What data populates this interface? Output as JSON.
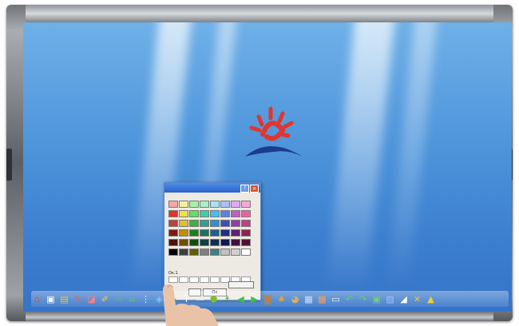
{
  "app": {
    "brand_colors": {
      "logo_red": "#e0362f",
      "logo_blue": "#1d3a8f"
    }
  },
  "palette": {
    "basic_colors": [
      "#f4a6a6",
      "#f6f0a0",
      "#a8f0a0",
      "#a8f0c8",
      "#a8e0f6",
      "#a8c0f6",
      "#e0a8f6",
      "#f6a8d8",
      "#e63030",
      "#f0e040",
      "#60e060",
      "#40d0a0",
      "#40c0f0",
      "#6080e0",
      "#c060c0",
      "#f060a0",
      "#c04040",
      "#e0c030",
      "#40b040",
      "#30a090",
      "#3090d0",
      "#4050b0",
      "#9040a0",
      "#c04080",
      "#801818",
      "#c09000",
      "#208020",
      "#207060",
      "#206090",
      "#203080",
      "#602070",
      "#902050",
      "#501010",
      "#705000",
      "#105010",
      "#104040",
      "#103050",
      "#101850",
      "#401040",
      "#501030",
      "#000000",
      "#404040",
      "#606000",
      "#808080",
      "#408080",
      "#c0c0c0",
      "#d0d0d0",
      "#ffffff"
    ],
    "custom_label": "Ок.1",
    "ok_label": "",
    "cancel_label": "Ок",
    "help_label": "?",
    "close_label": "×"
  },
  "toolbar": {
    "icons": [
      {
        "name": "home-icon",
        "glyph": "⌂",
        "color": "#e0502a"
      },
      {
        "name": "page-icon",
        "glyph": "▣",
        "color": "#ffffff"
      },
      {
        "name": "folder-icon",
        "glyph": "▤",
        "color": "#f0c040"
      },
      {
        "name": "pen-icon",
        "glyph": "✎",
        "color": "#ff5a3a"
      },
      {
        "name": "eraser-icon",
        "glyph": "◪",
        "color": "#ff8080"
      },
      {
        "name": "magic-pen-icon",
        "glyph": "✐",
        "color": "#f0d040"
      },
      {
        "name": "highlighter-icon",
        "glyph": "✑",
        "color": "#60c060"
      },
      {
        "name": "lines-icon",
        "glyph": "≡",
        "color": "#50d050"
      },
      {
        "name": "grip-icon",
        "glyph": "⋮",
        "color": "#ffffff"
      },
      {
        "name": "shape-icon",
        "glyph": "◈",
        "color": "#80c0ff"
      },
      {
        "name": "fill-icon",
        "glyph": "◆",
        "color": "#40b040"
      },
      {
        "name": "text-icon",
        "glyph": "T",
        "color": "#ffffff"
      },
      {
        "name": "line-icon",
        "glyph": "—",
        "color": "#ffffff"
      },
      {
        "name": "shield-icon",
        "glyph": "⬢",
        "color": "#7ac030"
      },
      {
        "name": "anchor-icon",
        "glyph": "⚓",
        "color": "#3a9a3a"
      },
      {
        "name": "arrow-left-icon",
        "glyph": "◀",
        "color": "#40c040"
      },
      {
        "name": "arrow-right-icon",
        "glyph": "▶",
        "color": "#40c040"
      },
      {
        "name": "camera-icon",
        "glyph": "◙",
        "color": "#c08040"
      },
      {
        "name": "bell-icon",
        "glyph": "♠",
        "color": "#f0a020"
      },
      {
        "name": "palette-icon",
        "glyph": "◕",
        "color": "#e0b060"
      },
      {
        "name": "keyboard-icon",
        "glyph": "▦",
        "color": "#d0e0f0"
      },
      {
        "name": "record-icon",
        "glyph": "▩",
        "color": "#f0a060"
      },
      {
        "name": "screen-icon",
        "glyph": "▭",
        "color": "#f0f0f0"
      },
      {
        "name": "undo-icon",
        "glyph": "↶",
        "color": "#60d060"
      },
      {
        "name": "redo-icon",
        "glyph": "↷",
        "color": "#60d060"
      },
      {
        "name": "image-icon",
        "glyph": "▣",
        "color": "#70d070"
      },
      {
        "name": "gallery-icon",
        "glyph": "▨",
        "color": "#a0c0ff"
      },
      {
        "name": "clear-icon",
        "glyph": "◢",
        "color": "#ffffff"
      },
      {
        "name": "tools-icon",
        "glyph": "✕",
        "color": "#f0c040"
      },
      {
        "name": "up-icon",
        "glyph": "▲",
        "color": "#f0d030"
      }
    ]
  }
}
